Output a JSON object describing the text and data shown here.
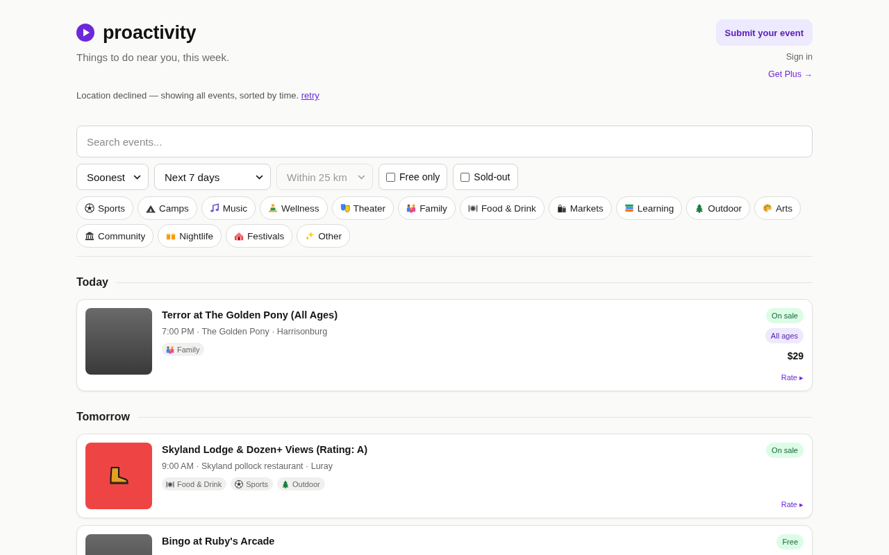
{
  "header": {
    "logo": "proactivity",
    "tagline": "Things to do near you, this week.",
    "submit_button": "Submit your event",
    "sign_in": "Sign in",
    "get_plus": "Get Plus →"
  },
  "location_notice": {
    "text": "Location declined — showing all events, sorted by time.",
    "link": "retry"
  },
  "search": {
    "placeholder": "Search events..."
  },
  "filters": {
    "selects": [
      {
        "value": "Soonest",
        "disabled": false
      },
      {
        "value": "Next 7 days",
        "disabled": false
      },
      {
        "value": "Within 25 km",
        "disabled": true
      }
    ],
    "toggles": [
      {
        "label": "Free only",
        "checked": false
      },
      {
        "label": "Sold-out",
        "checked": false
      }
    ]
  },
  "categories": [
    {
      "kind": "sports",
      "label": "Sports",
      "selected": false
    },
    {
      "kind": "camps",
      "label": "Camps",
      "selected": false
    },
    {
      "kind": "music",
      "label": "Music",
      "selected": false
    },
    {
      "kind": "wellness",
      "label": "Wellness",
      "selected": false
    },
    {
      "kind": "theater",
      "label": "Theater",
      "selected": false
    },
    {
      "kind": "family",
      "label": "Family",
      "selected": false
    },
    {
      "kind": "food",
      "label": "Food & Drink",
      "selected": false
    },
    {
      "kind": "markets",
      "label": "Markets",
      "selected": false
    },
    {
      "kind": "learning",
      "label": "Learning",
      "selected": false
    },
    {
      "kind": "outdoor",
      "label": "Outdoor",
      "selected": false
    },
    {
      "kind": "arts",
      "label": "Arts",
      "selected": false
    },
    {
      "kind": "community",
      "label": "Community",
      "selected": false
    },
    {
      "kind": "nightlife",
      "label": "Nightlife",
      "selected": false
    },
    {
      "kind": "festivals",
      "label": "Festivals",
      "selected": false
    },
    {
      "kind": "other",
      "label": "Other",
      "selected": false
    }
  ],
  "sections": [
    {
      "heading": "Today",
      "events": [
        {
          "title": "Terror at The Golden Pony (All Ages)",
          "meta": "7:00 PM · The Golden Pony · Harrisonburg",
          "image": {
            "kind": "photo"
          },
          "tags": [
            {
              "kind": "family",
              "label": "Family"
            }
          ],
          "badges": [
            {
              "kind": "status",
              "text": "On sale"
            },
            {
              "kind": "age",
              "text": "All ages"
            }
          ],
          "price": "$29",
          "rate": "Rate ▸"
        }
      ]
    },
    {
      "heading": "Tomorrow",
      "events": [
        {
          "title": "Skyland Lodge & Dozen+ Views (Rating: A)",
          "meta": "9:00 AM · Skyland pollock restaurant · Luray",
          "image": {
            "kind": "tile"
          },
          "tags": [
            {
              "kind": "food",
              "label": "Food & Drink"
            },
            {
              "kind": "sports",
              "label": "Sports"
            },
            {
              "kind": "outdoor",
              "label": "Outdoor"
            }
          ],
          "badges": [
            {
              "kind": "status",
              "text": "On sale"
            }
          ],
          "rate": "Rate ▸"
        },
        {
          "title": "Bingo at Ruby's Arcade",
          "image": {
            "kind": "photo"
          },
          "badges": [
            {
              "kind": "status",
              "text": "Free"
            }
          ]
        }
      ]
    }
  ]
}
